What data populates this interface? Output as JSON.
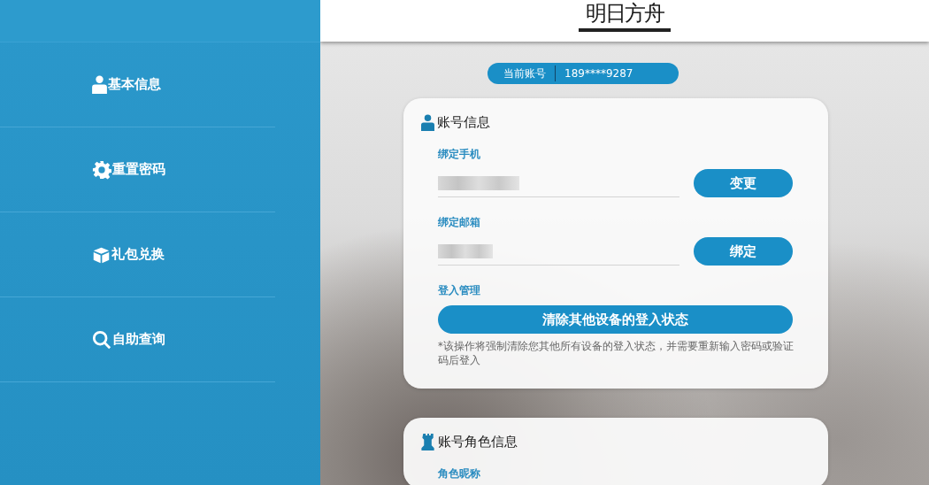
{
  "sidebar": {
    "items": [
      {
        "label": "基本信息"
      },
      {
        "label": "重置密码"
      },
      {
        "label": "礼包兑换"
      },
      {
        "label": "自助查询"
      }
    ]
  },
  "header": {
    "logo": "明日方舟"
  },
  "current_account": {
    "label": "当前账号",
    "value": "189****9287"
  },
  "account_card": {
    "title": "账号信息",
    "fields": [
      {
        "label": "绑定手机",
        "button": "变更"
      },
      {
        "label": "绑定邮箱",
        "button": "绑定"
      }
    ],
    "login_section": {
      "label": "登入管理",
      "button": "清除其他设备的登入状态",
      "note": "*该操作将强制清除您其他所有设备的登入状态，并需要重新输入密码或验证码后登入"
    }
  },
  "role_card": {
    "title": "账号角色信息",
    "field_label": "角色昵称"
  }
}
